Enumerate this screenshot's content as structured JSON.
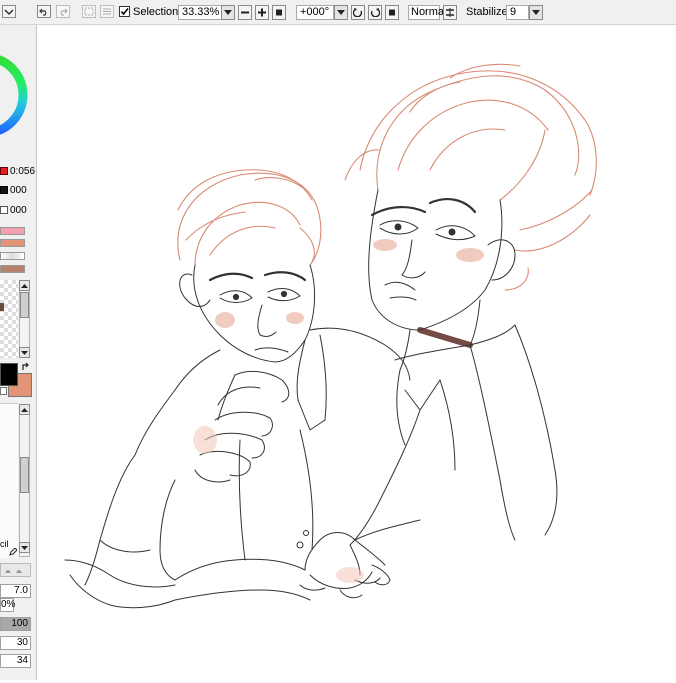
{
  "toolbar": {
    "selection_label": "Selection",
    "selection_checked": true,
    "zoom_value": "33.33%",
    "rotation_value": "+000°",
    "blend_mode": "Normal",
    "stabilizer_label": "Stabilizer",
    "stabilizer_value": "9"
  },
  "left_panel": {
    "color_readouts": [
      {
        "value": "0:056",
        "color": "#e02020"
      },
      {
        "value": "000",
        "color": "#111111"
      },
      {
        "value": "000",
        "color": "#ffffff"
      }
    ],
    "primary_color": "#000000",
    "secondary_color": "#e39476",
    "tool_label": "cil",
    "brush_size": "7.0",
    "density_value": "0%",
    "value_1": "100",
    "value_2": "30",
    "value_3": "34"
  },
  "colors": {
    "sketch_lineart": "#333333",
    "hair_lineart": "#d98a72",
    "blush": "#e8a18c",
    "neck_shadow": "#5a2a24"
  }
}
